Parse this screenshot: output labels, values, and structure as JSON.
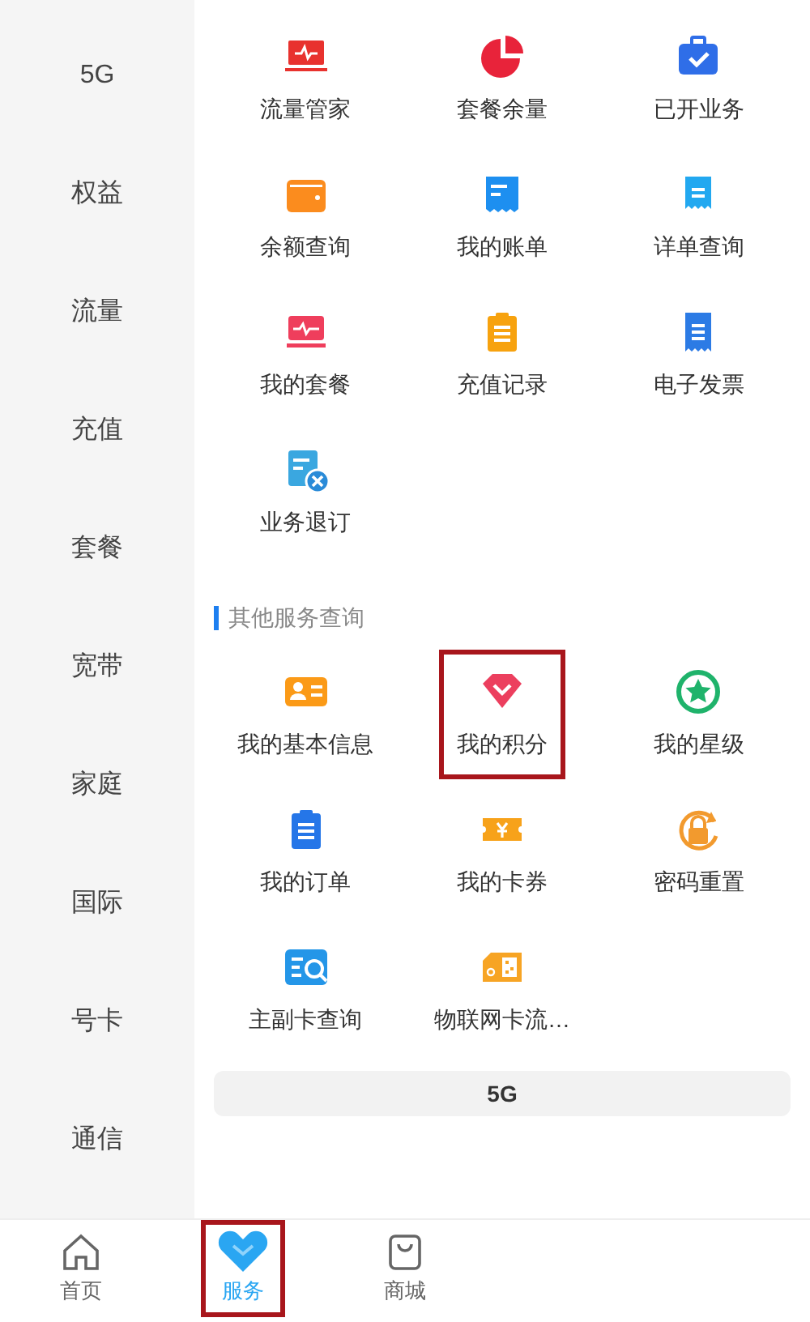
{
  "sidebar": {
    "items": [
      {
        "label": "5G",
        "selected": false
      },
      {
        "label": "权益",
        "selected": false
      },
      {
        "label": "流量",
        "selected": false
      },
      {
        "label": "充值",
        "selected": false
      },
      {
        "label": "套餐",
        "selected": false
      },
      {
        "label": "宽带",
        "selected": false
      },
      {
        "label": "家庭",
        "selected": false
      },
      {
        "label": "国际",
        "selected": false
      },
      {
        "label": "号卡",
        "selected": false
      },
      {
        "label": "通信",
        "selected": false
      }
    ]
  },
  "sections": [
    {
      "items": [
        {
          "label": "流量管家",
          "highlighted": false
        },
        {
          "label": "套餐余量",
          "highlighted": false
        },
        {
          "label": "已开业务",
          "highlighted": false
        },
        {
          "label": "余额查询",
          "highlighted": false
        },
        {
          "label": "我的账单",
          "highlighted": false
        },
        {
          "label": "详单查询",
          "highlighted": false
        },
        {
          "label": "我的套餐",
          "highlighted": false
        },
        {
          "label": "充值记录",
          "highlighted": false
        },
        {
          "label": "电子发票",
          "highlighted": false
        },
        {
          "label": "业务退订",
          "highlighted": false
        }
      ]
    },
    {
      "title": "其他服务查询",
      "items": [
        {
          "label": "我的基本信息",
          "highlighted": false
        },
        {
          "label": "我的积分",
          "highlighted": true
        },
        {
          "label": "我的星级",
          "highlighted": false
        },
        {
          "label": "我的订单",
          "highlighted": false
        },
        {
          "label": "我的卡券",
          "highlighted": false
        },
        {
          "label": "密码重置",
          "highlighted": false
        },
        {
          "label": "主副卡查询",
          "highlighted": false
        },
        {
          "label": "物联网卡流…",
          "highlighted": false
        }
      ]
    }
  ],
  "banner": {
    "label": "5G"
  },
  "bottom_nav": [
    {
      "label": "首页",
      "selected": false,
      "highlighted": false
    },
    {
      "label": "服务",
      "selected": true,
      "highlighted": true
    },
    {
      "label": "商城",
      "selected": false,
      "highlighted": false
    }
  ]
}
